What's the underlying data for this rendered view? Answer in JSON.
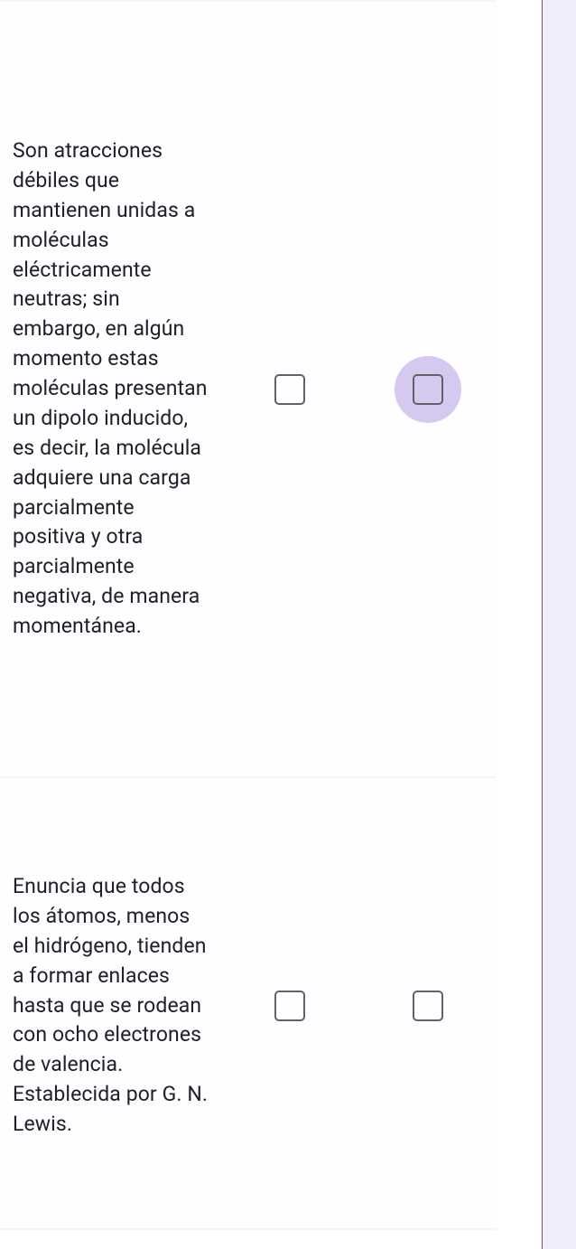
{
  "rows": [
    {
      "text": "Son atracciones débiles que mantienen unidas a moléculas eléctricamente neutras; sin embargo, en algún momento estas moléculas presentan un dipolo inducido, es decir, la molécula adquiere una carga parcialmente positiva  y otra parcialmente negativa, de manera momentánea.",
      "checkbox1_checked": false,
      "checkbox2_checked": false,
      "checkbox2_focused": true
    },
    {
      "text": "Enuncia que todos los átomos, menos el hidrógeno, tienden a formar enlaces hasta que se rodean con ocho electrones de valencia. Establecida por G. N. Lewis.",
      "checkbox1_checked": false,
      "checkbox2_checked": false,
      "checkbox2_focused": false
    }
  ]
}
